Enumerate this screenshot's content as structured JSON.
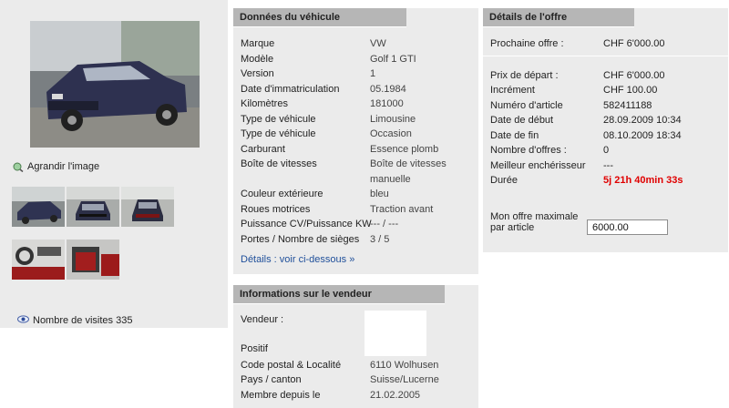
{
  "gallery": {
    "enlarge_label": "Agrandir l'image",
    "visits_label": "Nombre de visites 335"
  },
  "vehicle": {
    "title": "Données du véhicule",
    "rows": [
      {
        "k": "Marque",
        "v": "VW"
      },
      {
        "k": "Modèle",
        "v": "Golf 1 GTI"
      },
      {
        "k": "Version",
        "v": "1"
      },
      {
        "k": "Date d'immatriculation",
        "v": "05.1984"
      },
      {
        "k": "Kilomètres",
        "v": "181000"
      },
      {
        "k": "Type de véhicule",
        "v": "Limousine"
      },
      {
        "k": "Type de véhicule",
        "v": "Occasion"
      },
      {
        "k": "Carburant",
        "v": "Essence plomb"
      },
      {
        "k": "Boîte de vitesses",
        "v": "Boîte de vitesses",
        "v2": "manuelle"
      },
      {
        "k": "Couleur extérieure",
        "v": "bleu"
      },
      {
        "k": "Roues motrices",
        "v": "Traction avant"
      },
      {
        "k": "Puissance CV/Puissance KW",
        "v": "--- / ---"
      },
      {
        "k": "Portes / Nombre de sièges",
        "v": "3 / 5"
      }
    ],
    "details_link": "Détails : voir ci-dessous »"
  },
  "seller": {
    "title": "Informations sur le vendeur",
    "vendeur_label": "Vendeur :",
    "rating": "Positif",
    "rows": [
      {
        "k": "Code postal & Localité",
        "v": "6110 Wolhusen"
      },
      {
        "k": "Pays / canton",
        "v": "Suisse/Lucerne"
      },
      {
        "k": "Membre depuis le",
        "v": "21.02.2005"
      }
    ]
  },
  "offer": {
    "title": "Détails de l'offre",
    "next_label": "Prochaine offre :",
    "next_value": "CHF 6'000.00",
    "rows": [
      {
        "k": "Prix de départ :",
        "v": "CHF 6'000.00"
      },
      {
        "k": "Incrément",
        "v": "CHF 100.00"
      },
      {
        "k": "Numéro d'article",
        "v": "582411188"
      },
      {
        "k": "Date de début",
        "v": "28.09.2009 10:34"
      },
      {
        "k": "Date de fin",
        "v": "08.10.2009 18:34"
      },
      {
        "k": "Nombre d'offres :",
        "v": "0"
      },
      {
        "k": "Meilleur enchérisseur",
        "v": "---"
      },
      {
        "k": "Durée",
        "v": "5j 21h 40min 33s"
      }
    ],
    "max_label_1": "Mon offre maximale",
    "max_label_2": "par article",
    "max_value": "6000.00"
  },
  "colors": {
    "panel_bg": "#ebebeb",
    "header_bg": "#b6b6b6",
    "link": "#1f4f9a",
    "alert": "#e00000"
  }
}
